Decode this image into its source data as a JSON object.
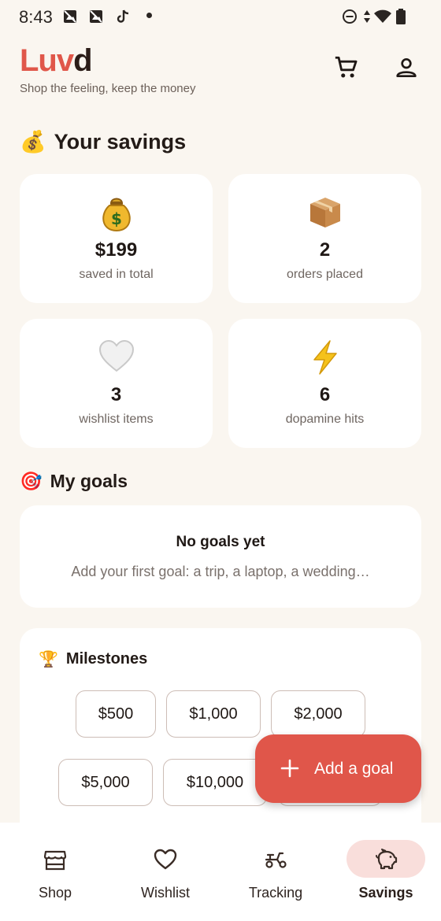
{
  "status_bar": {
    "time": "8:43",
    "icons": [
      "photo-notification-icon",
      "photo-notification-icon",
      "tiktok-icon",
      "notification-dot",
      "do-not-disturb-icon",
      "data-arrows-icon",
      "wifi-icon",
      "battery-icon"
    ]
  },
  "header": {
    "logo_part1": "Luv",
    "logo_part2": "d",
    "tagline": "Shop the feeling, keep the money",
    "icons": [
      "cart-icon",
      "account-icon"
    ]
  },
  "savings": {
    "title_emoji": "💰",
    "title": "Your savings",
    "stats": [
      {
        "emoji": "💰",
        "icon": "money-bag-icon",
        "value": "$199",
        "label": "saved in total"
      },
      {
        "emoji": "📦",
        "icon": "package-icon",
        "value": "2",
        "label": "orders placed"
      },
      {
        "emoji": "🤍",
        "icon": "white-heart-icon",
        "value": "3",
        "label": "wishlist items"
      },
      {
        "emoji": "⚡",
        "icon": "lightning-icon",
        "value": "6",
        "label": "dopamine hits"
      }
    ]
  },
  "goals": {
    "title_emoji": "🎯",
    "title": "My goals",
    "empty_title": "No goals yet",
    "empty_subtitle": "Add your first goal: a trip, a laptop, a wedding…"
  },
  "milestones": {
    "title_emoji": "🏆",
    "title": "Milestones",
    "chips": [
      "$500",
      "$1,000",
      "$2,000",
      "$5,000",
      "$10,000"
    ]
  },
  "fab": {
    "label": "Add a goal",
    "icon": "plus-icon"
  },
  "nav": {
    "items": [
      {
        "label": "Shop",
        "icon": "store-icon",
        "active": false
      },
      {
        "label": "Wishlist",
        "icon": "heart-icon",
        "active": false
      },
      {
        "label": "Tracking",
        "icon": "scooter-icon",
        "active": false
      },
      {
        "label": "Savings",
        "icon": "piggy-bank-icon",
        "active": true
      }
    ]
  },
  "colors": {
    "accent": "#e0564a",
    "background": "#faf6f0",
    "card": "#ffffff",
    "nav_active_pill": "#f9dedb",
    "chip_border": "#cdbdb6"
  }
}
